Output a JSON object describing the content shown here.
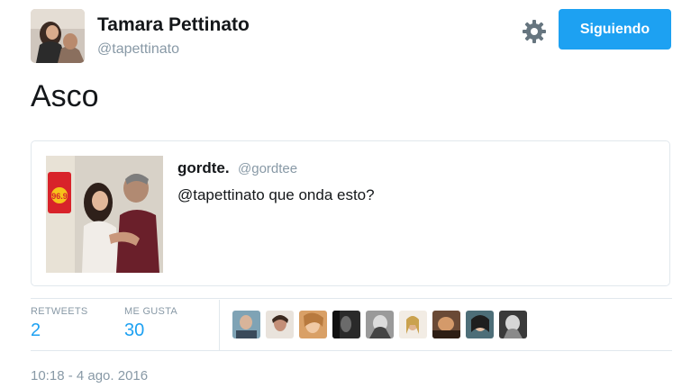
{
  "author": {
    "name": "Tamara Pettinato",
    "handle": "@tapettinato"
  },
  "actions": {
    "follow_label": "Siguiendo"
  },
  "tweet": {
    "text": "Asco"
  },
  "quoted": {
    "name": "gordte.",
    "handle": "@gordtee",
    "text": "@tapettinato que onda esto?",
    "sign_text": "96.9"
  },
  "stats": {
    "retweets_label": "RETWEETS",
    "retweets_value": "2",
    "likes_label": "ME GUSTA",
    "likes_value": "30"
  },
  "timestamp": "10:18 - 4 ago. 2016",
  "colors": {
    "accent": "#1da1f2",
    "muted": "#8899a6",
    "border": "#e1e8ed"
  }
}
